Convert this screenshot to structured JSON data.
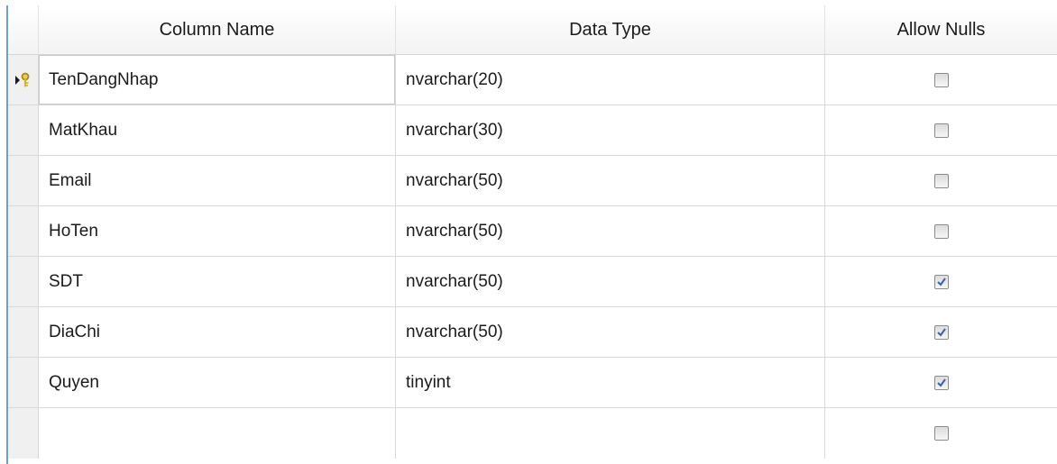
{
  "header": {
    "column_name": "Column Name",
    "data_type": "Data Type",
    "allow_nulls": "Allow Nulls"
  },
  "rows": [
    {
      "name": "TenDangNhap",
      "type": "nvarchar(20)",
      "allow_nulls": false,
      "primary_key": true
    },
    {
      "name": "MatKhau",
      "type": "nvarchar(30)",
      "allow_nulls": false
    },
    {
      "name": "Email",
      "type": "nvarchar(50)",
      "allow_nulls": false
    },
    {
      "name": "HoTen",
      "type": "nvarchar(50)",
      "allow_nulls": false
    },
    {
      "name": "SDT",
      "type": "nvarchar(50)",
      "allow_nulls": true
    },
    {
      "name": "DiaChi",
      "type": "nvarchar(50)",
      "allow_nulls": true
    },
    {
      "name": "Quyen",
      "type": "tinyint",
      "allow_nulls": true
    },
    {
      "name": "",
      "type": "",
      "allow_nulls": false
    }
  ],
  "icons": {
    "current_row": "row-arrow-key-icon",
    "checkbox": "checkbox-icon"
  },
  "colors": {
    "left_rule": "#6f9fd8",
    "key_gold": "#d8b02a"
  }
}
